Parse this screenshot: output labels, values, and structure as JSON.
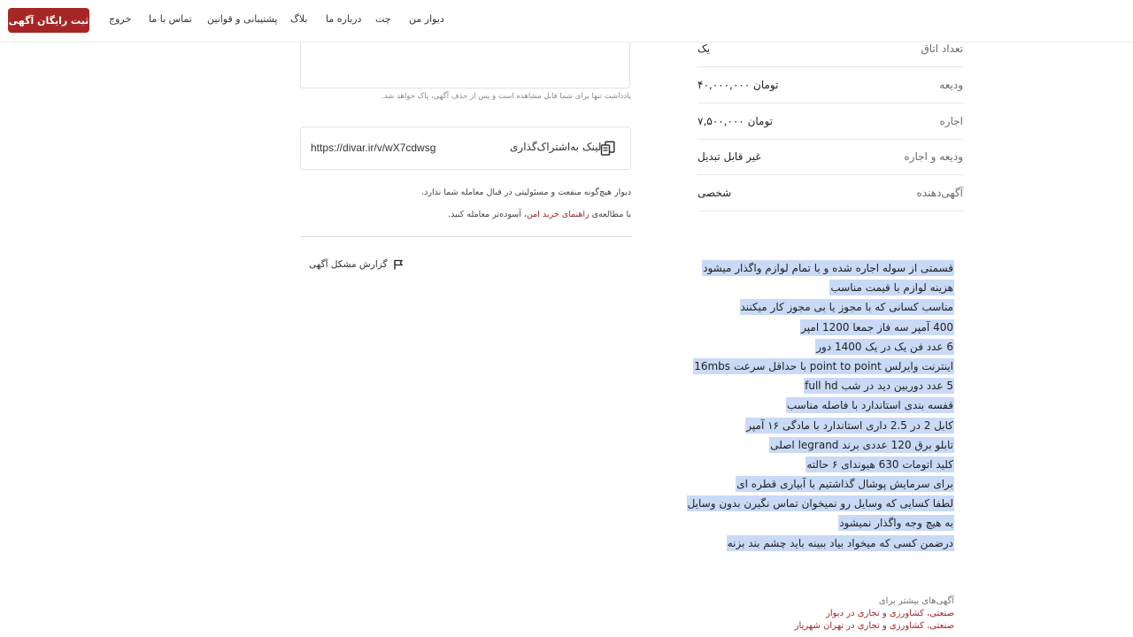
{
  "header": {
    "post_button": "ثبت رایگان آگهی",
    "nav": {
      "exit": "خروج",
      "contact": "تماس با ما",
      "support": "پشتیبانی و قوانین",
      "blog": "بلاگ",
      "about": "درباره ما",
      "chat": "چت",
      "my_divar": "دیوار من"
    }
  },
  "note": {
    "hint": "یادداشت تنها برای شما قابل مشاهده است و پس از حذف آگهی، پاک خواهد شد."
  },
  "share": {
    "label": "لینک به‌اشتراک‌گذاری",
    "url": "https://divar.ir/v/wX7cdwsg",
    "icon": "copy-icon"
  },
  "disclaimer": {
    "line1": "دیوار هیچ‌گونه منفعت و مسئولیتی در قبال معامله شما ندارد.",
    "line2_prefix": "با مطالعه‌ی ",
    "line2_link": "راهنمای خرید امن",
    "line2_suffix": "، آسوده‌تر معامله کنید."
  },
  "report": {
    "label": "گزارش مشکل آگهی",
    "icon": "flag-icon"
  },
  "info_rows": [
    {
      "label": "تعداد اتاق",
      "value": "یک"
    },
    {
      "label": "ودیعه",
      "value": "۴۰,۰۰۰,۰۰۰ تومان"
    },
    {
      "label": "اجاره",
      "value": "۷,۵۰۰,۰۰۰ تومان"
    },
    {
      "label": "ودیعه و اجاره",
      "value": "غیر قابل تبدیل"
    },
    {
      "label": "آگهی‌دهنده",
      "value": "شخصی"
    }
  ],
  "description": [
    "قسمتی از سوله اجاره شده و با تمام لوازم واگذار میشود",
    "هزینه لوازم با قیمت مناسب",
    "مناسب کسانی که با مجوز یا بی مجوز کار میکنند",
    "400 آمپر سه فاز جمعا 1200 امپر",
    "6 عدد فن یک در یک 1400 دور",
    "اینترنت وایرلس point to point با حداقل سرعت 16mbs",
    "5 عدد دوربین دید در شب full hd",
    "قفسه بندی استاندارد با فاصله مناسب",
    "کابل 2 در 2.5 داری استاندارد  با مادگی ۱۶ آمپر",
    "تابلو برق 120 عددی برند legrand اصلی",
    "کلید اتومات 630 هیوندای ۶ حالته",
    "برای سرمایش پوشال گذاشتیم با آبیاری قطره ای",
    "لطفا کسایی که وسایل رو نمیخوان تماس نگیرن بدون وسایل",
    "به هیچ وجه واگذار نمیشود",
    "درضمن کسی که میخواد بیاد ببینه باید چشم بند بزنه"
  ],
  "more_ads": {
    "title": "آگهی‌های بیشتر برای",
    "links": [
      "صنعتی، کشاورزی و تجاری در دیوار",
      "صنعتی، کشاورزی و تجاری در تهران شهریار"
    ]
  },
  "colors": {
    "brand": "#a62626",
    "selection": "#c9daf7"
  }
}
